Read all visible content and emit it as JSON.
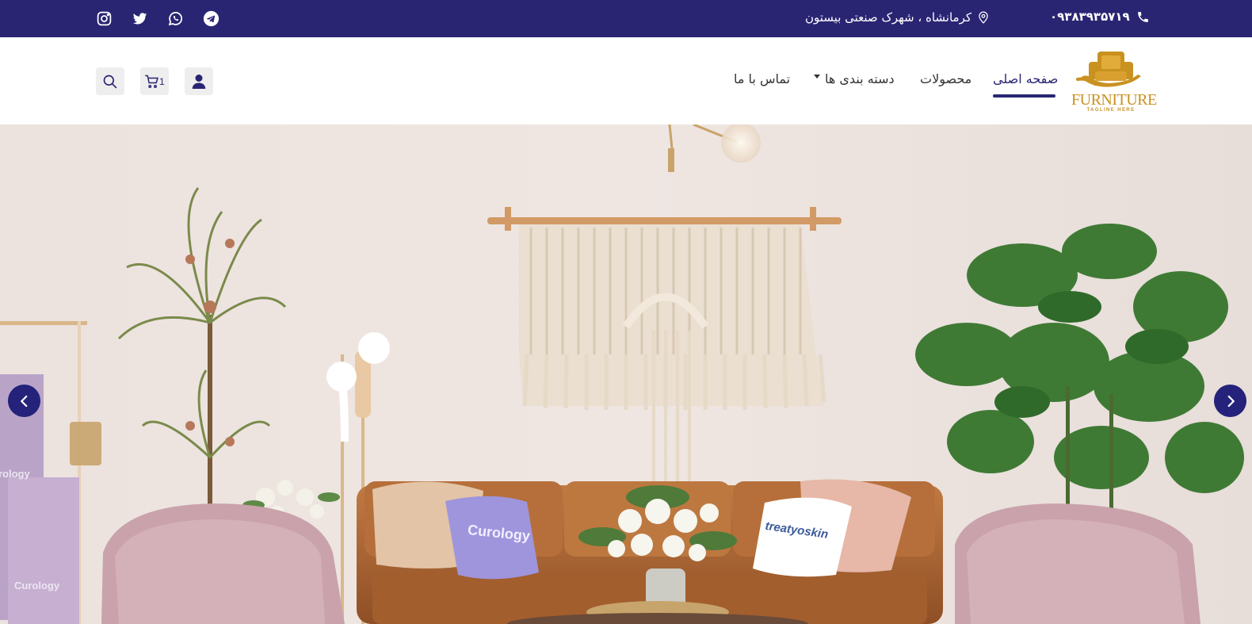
{
  "topbar": {
    "phone": "۰۹۳۸۳۹۳۵۷۱۹",
    "address": "کرمانشاه ، شهرک صنعتی بیستون",
    "social_icons": [
      "instagram-icon",
      "twitter-icon",
      "whatsapp-icon",
      "telegram-icon"
    ],
    "background": "#2a2573"
  },
  "header": {
    "logo": {
      "brand": "FURNITURE",
      "tagline": "TAGLINE HERE",
      "color": "#c9911f"
    },
    "nav": [
      {
        "label": "صفحه اصلی",
        "active": true
      },
      {
        "label": "محصولات"
      },
      {
        "label": "دسته بندی ها",
        "has_dropdown": true
      },
      {
        "label": "تماس با ما"
      }
    ],
    "actions": {
      "user_icon": "user-icon",
      "cart_icon": "cart-icon",
      "cart_count": "1",
      "search_icon": "search-icon"
    }
  },
  "hero": {
    "pillow_left": "Curology",
    "pillow_right": "treatyoskin",
    "towel_1": "rology",
    "towel_2": "Curology",
    "prev_icon": "chevron-left-icon",
    "next_icon": "chevron-right-icon",
    "arrow_color": "#24227a"
  }
}
